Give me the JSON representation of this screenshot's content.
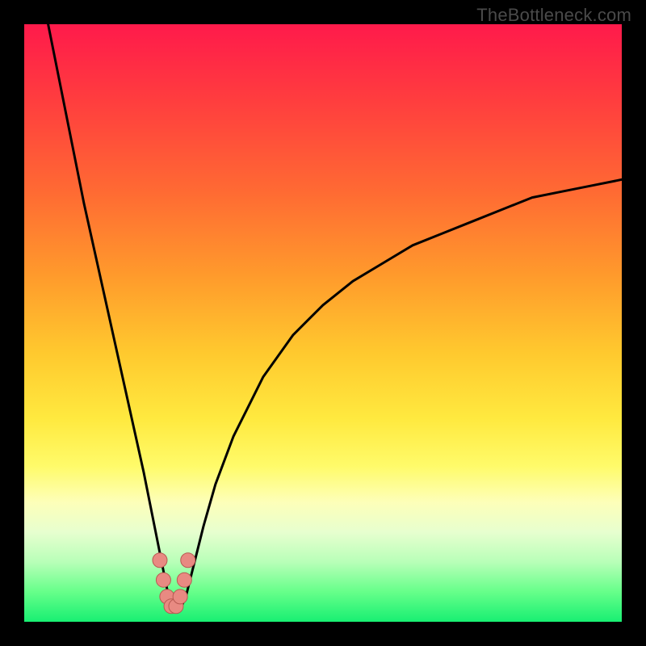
{
  "watermark": "TheBottleneck.com",
  "colors": {
    "frame": "#000000",
    "curve_stroke": "#000000",
    "marker_fill": "#e88a82",
    "marker_stroke": "#b85a52"
  },
  "chart_data": {
    "type": "line",
    "title": "",
    "xlabel": "",
    "ylabel": "",
    "xlim": [
      0,
      100
    ],
    "ylim": [
      0,
      100
    ],
    "grid": false,
    "legend": false,
    "description": "Bottleneck mismatch percentage curve. Y ≈ 100 (maximum bottleneck, red) at the extremes, dipping to ≈ 0 (no bottleneck, green) near x ≈ 25. Left branch falls steeply from (4,100) to the valley; right branch rises from the valley asymptotically toward y ≈ 75 at x = 100.",
    "series": [
      {
        "name": "bottleneck-curve",
        "x": [
          4,
          6,
          8,
          10,
          12,
          14,
          16,
          18,
          20,
          22,
          23,
          24,
          25,
          26,
          27,
          28,
          30,
          32,
          35,
          40,
          45,
          50,
          55,
          60,
          65,
          70,
          75,
          80,
          85,
          90,
          95,
          100
        ],
        "y": [
          100,
          90,
          80,
          70,
          61,
          52,
          43,
          34,
          25,
          15,
          10,
          5,
          2,
          2,
          4,
          8,
          16,
          23,
          31,
          41,
          48,
          53,
          57,
          60,
          63,
          65,
          67,
          69,
          71,
          72,
          73,
          74
        ]
      }
    ],
    "markers": [
      {
        "x": 22.7,
        "y": 10.3
      },
      {
        "x": 23.3,
        "y": 7.0
      },
      {
        "x": 23.9,
        "y": 4.2
      },
      {
        "x": 24.6,
        "y": 2.6
      },
      {
        "x": 25.4,
        "y": 2.6
      },
      {
        "x": 26.1,
        "y": 4.2
      },
      {
        "x": 26.8,
        "y": 7.0
      },
      {
        "x": 27.4,
        "y": 10.3
      }
    ]
  }
}
